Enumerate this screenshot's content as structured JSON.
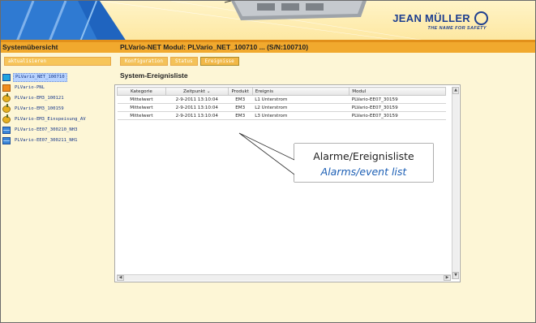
{
  "header": {
    "brand": "JEAN MÜLLER",
    "tagline": "THE NAME FOR SAFETY"
  },
  "title_bar": {
    "left": "Systemübersicht",
    "module": "PLVario-NET Modul: PLVario_NET_100710 ... (S/N:100710)"
  },
  "sidebar": {
    "refresh_label": "aktualisieren",
    "items": [
      {
        "label": "PLVario_NET_100710",
        "icon": "network-device-icon",
        "selected": true
      },
      {
        "label": "PLVario-PNL",
        "icon": "panel-icon",
        "selected": false
      },
      {
        "label": "PLVario-EM3_100121",
        "icon": "meter-icon",
        "selected": false
      },
      {
        "label": "PLVario-EM3_100159",
        "icon": "meter-icon",
        "selected": false
      },
      {
        "label": "PLVario-EM3_Einspeisung_AV",
        "icon": "meter-icon",
        "selected": false
      },
      {
        "label": "PLVario-EE07_300210_NH3",
        "icon": "switch-disconnector-icon",
        "selected": false
      },
      {
        "label": "PLVario-EE07_300211_NH1",
        "icon": "switch-disconnector-icon",
        "selected": false
      }
    ]
  },
  "tabs": [
    {
      "label": "Konfiguration",
      "active": false
    },
    {
      "label": "Status",
      "active": false
    },
    {
      "label": "Ereignisse",
      "active": true
    }
  ],
  "main": {
    "section_title": "System-Ereignisliste",
    "columns": [
      "Kategorie",
      "Zeitpunkt",
      "Produkt",
      "Ereignis",
      "Modul"
    ],
    "sort_indicator": "⌄",
    "rows": [
      {
        "kategorie": "Mittelwert",
        "zeitpunkt": "2-9-2011 13:10:04",
        "produkt": "EM3",
        "ereignis": "L1 Unterstrom",
        "modul": "PLVario-EE07_30159"
      },
      {
        "kategorie": "Mittelwert",
        "zeitpunkt": "2-9-2011 13:10:04",
        "produkt": "EM3",
        "ereignis": "L2 Unterstrom",
        "modul": "PLVario-EE07_30159"
      },
      {
        "kategorie": "Mittelwert",
        "zeitpunkt": "2-9-2011 13:10:04",
        "produkt": "EM3",
        "ereignis": "L3 Unterstrom",
        "modul": "PLVario-EE07_30159"
      }
    ]
  },
  "callout": {
    "german": "Alarme/Ereignisliste",
    "english": "Alarms/event list"
  },
  "colors": {
    "accent_orange": "#f1a92e",
    "background": "#fdf6d6",
    "brand_blue": "#1f3f8f",
    "callout_blue": "#1c5fb5"
  }
}
